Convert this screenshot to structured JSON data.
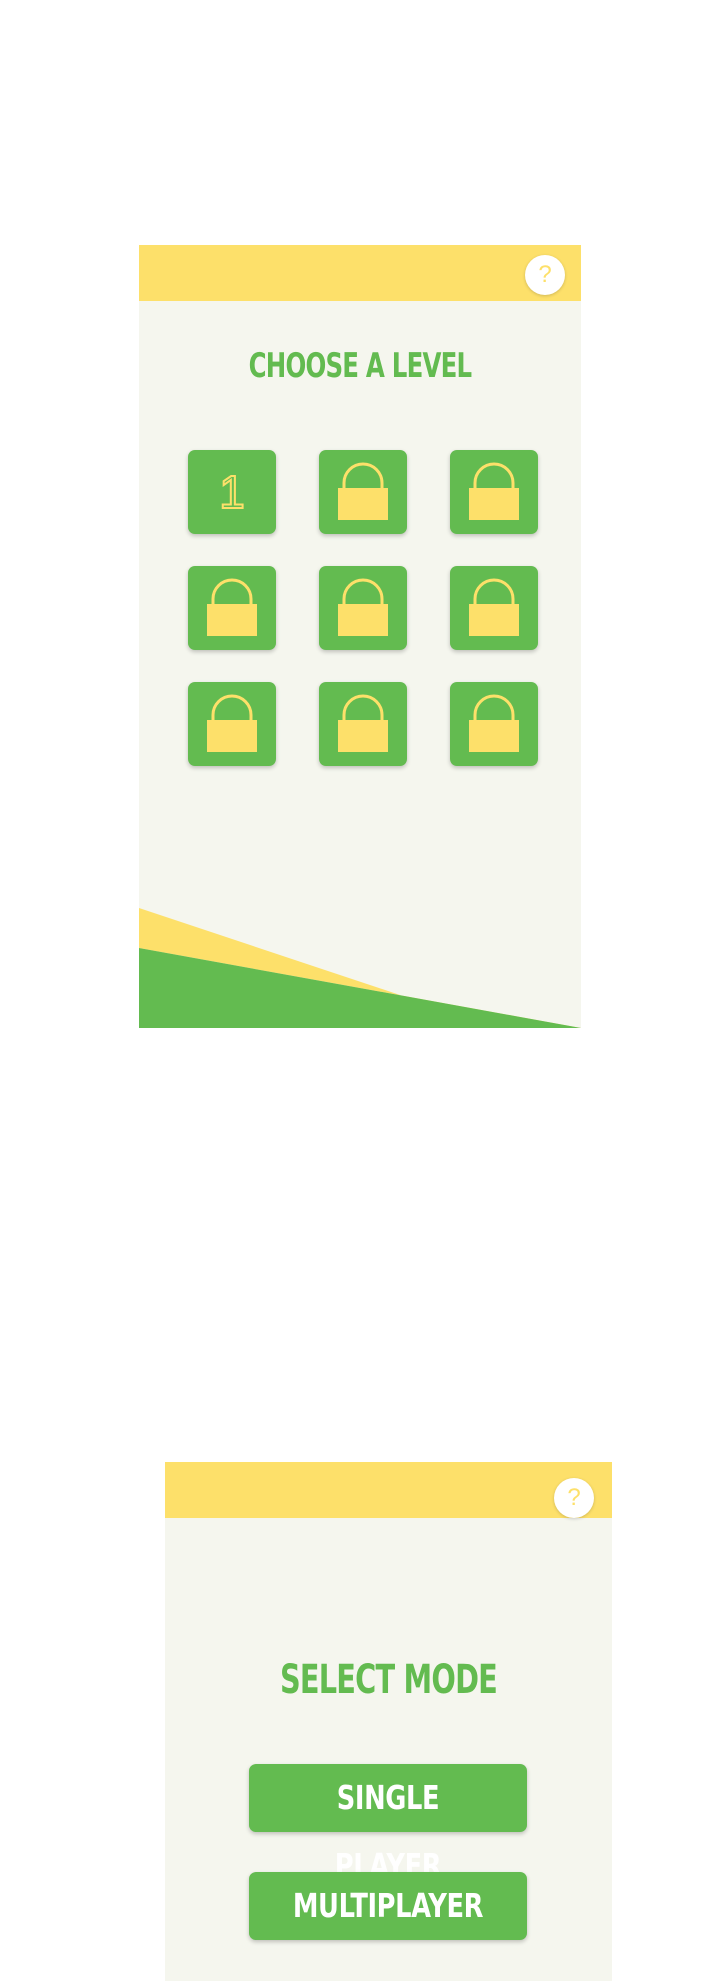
{
  "level_screen": {
    "help_label": "?",
    "title": "CHOOSE A LEVEL",
    "levels": [
      {
        "label": "1",
        "locked": false
      },
      {
        "label": "",
        "locked": true
      },
      {
        "label": "",
        "locked": true
      },
      {
        "label": "",
        "locked": true
      },
      {
        "label": "",
        "locked": true
      },
      {
        "label": "",
        "locked": true
      },
      {
        "label": "",
        "locked": true
      },
      {
        "label": "",
        "locked": true
      },
      {
        "label": "",
        "locked": true
      }
    ]
  },
  "mode_screen": {
    "help_label": "?",
    "title": "SELECT MODE",
    "single_player_label": "SINGLE PLAYER",
    "multiplayer_label": "MULTIPLAYER"
  },
  "colors": {
    "green": "#63bb50",
    "yellow": "#fde06a",
    "background": "#f5f6ee"
  },
  "icons": {
    "help": "question-mark-icon",
    "locked": "lock-icon"
  }
}
